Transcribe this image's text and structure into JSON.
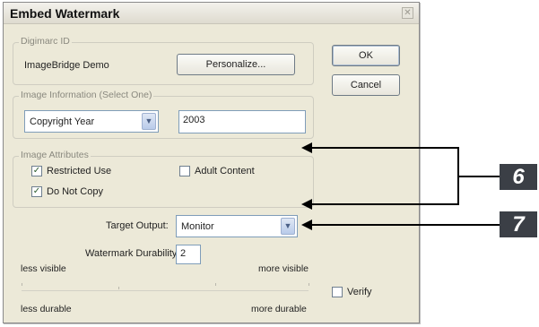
{
  "dialog": {
    "title": "Embed Watermark",
    "close_icon": "✕"
  },
  "digimarc": {
    "legend": "Digimarc ID",
    "id_value": "ImageBridge Demo",
    "personalize_label": "Personalize..."
  },
  "buttons": {
    "ok_label": "OK",
    "cancel_label": "Cancel"
  },
  "image_info": {
    "legend": "Image Information (Select One)",
    "type_selected": "Copyright Year",
    "year_value": "2003"
  },
  "attributes": {
    "legend": "Image Attributes",
    "restricted_use": {
      "label": "Restricted Use",
      "checked": true
    },
    "adult_content": {
      "label": "Adult Content",
      "checked": false
    },
    "do_not_copy": {
      "label": "Do Not Copy",
      "checked": true
    }
  },
  "target_output": {
    "label": "Target Output:",
    "selected": "Monitor"
  },
  "durability": {
    "label": "Watermark Durability:",
    "value": "2",
    "less_visible": "less visible",
    "more_visible": "more visible",
    "less_durable": "less durable",
    "more_durable": "more durable"
  },
  "verify": {
    "label": "Verify",
    "checked": false
  },
  "callouts": {
    "six": "6",
    "seven": "7",
    "color": "#3b3f46"
  }
}
